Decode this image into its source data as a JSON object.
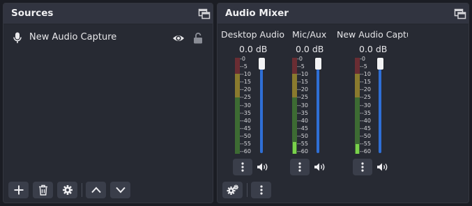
{
  "sources": {
    "title": "Sources",
    "items": [
      {
        "name": "New Audio Capture",
        "icon": "microphone-icon",
        "visible": true,
        "locked": false
      }
    ],
    "toolbar": [
      "add-icon",
      "remove-icon",
      "properties-icon",
      "move-up-icon",
      "move-down-icon"
    ]
  },
  "mixer": {
    "title": "Audio Mixer",
    "scale": [
      "0",
      "-5",
      "-10",
      "-15",
      "-20",
      "-25",
      "-30",
      "-35",
      "-40",
      "-45",
      "-50",
      "-55",
      "-60"
    ],
    "channels": [
      {
        "name": "Desktop Audio",
        "db": "0.0 dB",
        "level": 0
      },
      {
        "name": "Mic/Aux",
        "db": "0.0 dB",
        "level": 0.12
      },
      {
        "name": "New Audio Captu",
        "db": "0.0 dB",
        "level": 0.1
      }
    ],
    "toolbar": [
      "advanced-audio-gear-icon",
      "mixer-menu-icon"
    ]
  },
  "colors": {
    "background": "#1b1d24",
    "dock": "#272a33",
    "header": "#313440",
    "button": "#3a3e4a",
    "accent": "#2f6fd6",
    "meter_green": "#7ad24b",
    "meter_yellow": "#8a7a2e",
    "meter_red": "#6a2d33"
  }
}
